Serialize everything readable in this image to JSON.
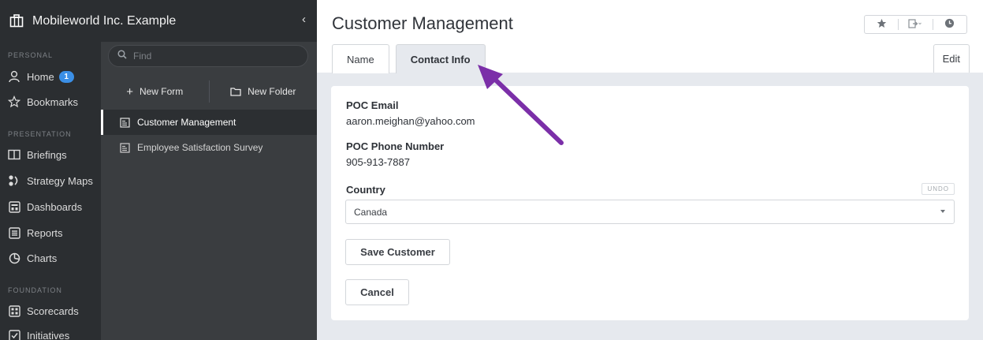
{
  "app": {
    "org_name": "Mobileworld Inc. Example",
    "collapse_glyph": "‹"
  },
  "nav": {
    "sections": [
      {
        "label": "PERSONAL",
        "items": [
          {
            "label": "Home",
            "icon": "user-icon",
            "badge": "1"
          },
          {
            "label": "Bookmarks",
            "icon": "star-icon"
          }
        ]
      },
      {
        "label": "PRESENTATION",
        "items": [
          {
            "label": "Briefings",
            "icon": "book-icon"
          },
          {
            "label": "Strategy Maps",
            "icon": "strategy-map-icon"
          },
          {
            "label": "Dashboards",
            "icon": "dashboard-icon"
          },
          {
            "label": "Reports",
            "icon": "report-icon"
          },
          {
            "label": "Charts",
            "icon": "pie-chart-icon"
          }
        ]
      },
      {
        "label": "FOUNDATION",
        "items": [
          {
            "label": "Scorecards",
            "icon": "scorecard-icon"
          },
          {
            "label": "Initiatives",
            "icon": "checkbox-icon"
          }
        ]
      }
    ]
  },
  "forms_panel": {
    "search_placeholder": "Find",
    "new_form_label": "New Form",
    "new_folder_label": "New Folder",
    "items": [
      {
        "label": "Customer Management",
        "active": true
      },
      {
        "label": "Employee Satisfaction Survey",
        "active": false
      }
    ]
  },
  "main": {
    "title": "Customer Management",
    "tabs": [
      {
        "label": "Name",
        "active": false
      },
      {
        "label": "Contact Info",
        "active": true
      }
    ],
    "edit_label": "Edit",
    "fields": {
      "poc_email_label": "POC Email",
      "poc_email_value": "aaron.meighan@yahoo.com",
      "poc_phone_label": "POC Phone Number",
      "poc_phone_value": "905-913-7887",
      "country_label": "Country",
      "country_value": "Canada",
      "undo_label": "UNDO"
    },
    "save_label": "Save Customer",
    "cancel_label": "Cancel"
  },
  "colors": {
    "sidebar_bg": "#2b2e31",
    "panel_bg": "#3a3d40",
    "main_bg": "#e6e9ee",
    "badge": "#3b8fe6",
    "annotation_arrow": "#7b2fa8"
  }
}
